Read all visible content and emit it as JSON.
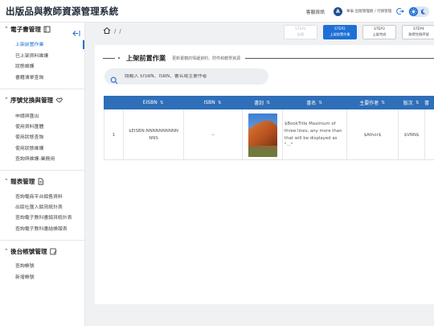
{
  "app": {
    "title": "出版品與教師資源管理系統"
  },
  "header": {
    "customer_service": "客服資訊",
    "avatar_letter": "A",
    "user_name": "華泰 出版管理組 / 行銷管理組"
  },
  "sidebar": {
    "sections": [
      {
        "title": "電子書管理",
        "items": [
          "上架前置作業",
          "已上架資料維護",
          "狀態維護",
          "書籍清單查詢"
        ]
      },
      {
        "title": "序號兌換與管理",
        "items": [
          "申請與匯出",
          "使用資料匯體",
          "使用狀態查詢",
          "使用狀態維護",
          "查詢與維護-業務用"
        ]
      },
      {
        "title": "報表管理",
        "items": [
          "查詢電商平台銷售資料",
          "出版社匯入銷貨統計表",
          "查詢電子教科書銷貨統計表",
          "查詢電子教科書結帳報表"
        ]
      },
      {
        "title": "後台帳號管理",
        "items": [
          "查詢帳號",
          "新增帳號"
        ]
      }
    ],
    "active_item": "上架前置作業"
  },
  "breadcrumb": {
    "sep1": "/",
    "sep2": "/"
  },
  "steps": [
    {
      "label": "STEP1",
      "sub": "出版",
      "state": "dim"
    },
    {
      "label": "STEP2",
      "sub": "上架前置作業",
      "state": "current"
    },
    {
      "label": "STEP3",
      "sub": "上架完成",
      "state": "next"
    },
    {
      "label": "STEP4",
      "sub": "取得兌換序號",
      "state": "next"
    }
  ],
  "panel": {
    "title": "上架前置作業",
    "subtitle": "更新書籍的情緩資料、附件和教學資源"
  },
  "search": {
    "placeholder": "請輸入 EISBN、ISBN、書名或主要作者"
  },
  "table": {
    "columns": [
      "EISBN",
      "ISBN",
      "書封",
      "書名",
      "主要作者",
      "版次",
      "書"
    ],
    "rows": [
      {
        "index": "1",
        "eisbn": "$EISBN-NNNNNNNNNNNNS",
        "isbn": "--",
        "title": "$BookTitle Maximum of three lines, any more than that will be displayed as \"...\"",
        "author": "$Athor$",
        "edition": "$VNN$"
      }
    ]
  },
  "colors": {
    "accent": "#1d6fd6",
    "table_header": "#2f6eb8",
    "sidebar_bg": "#ffffff",
    "page_bg": "#f0f1f3"
  }
}
